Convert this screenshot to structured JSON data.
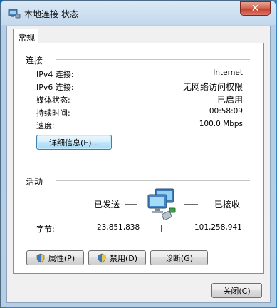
{
  "window": {
    "title": "本地连接 状态",
    "close_glyph": "✕"
  },
  "tabs": [
    {
      "label": "常规"
    }
  ],
  "connection": {
    "section_title": "连接",
    "rows": [
      {
        "label": "IPv4 连接:",
        "value": "Internet"
      },
      {
        "label": "IPv6 连接:",
        "value": "无网络访问权限"
      },
      {
        "label": "媒体状态:",
        "value": "已启用"
      },
      {
        "label": "持续时间:",
        "value": "00:58:09"
      },
      {
        "label": "速度:",
        "value": "100.0 Mbps"
      }
    ],
    "details_button": "详细信息(E)..."
  },
  "activity": {
    "section_title": "活动",
    "sent_label": "已发送",
    "received_label": "已接收",
    "bytes_label": "字节:",
    "bytes_sent": "23,851,838",
    "bytes_received": "101,258,941"
  },
  "actions": {
    "properties": "属性(P)",
    "disable": "禁用(D)",
    "diagnose": "诊断(G)"
  },
  "footer": {
    "close": "关闭(C)"
  },
  "icons": {
    "app": "network-connection-icon",
    "shield": "uac-shield-icon",
    "activity": "network-activity-icon"
  }
}
